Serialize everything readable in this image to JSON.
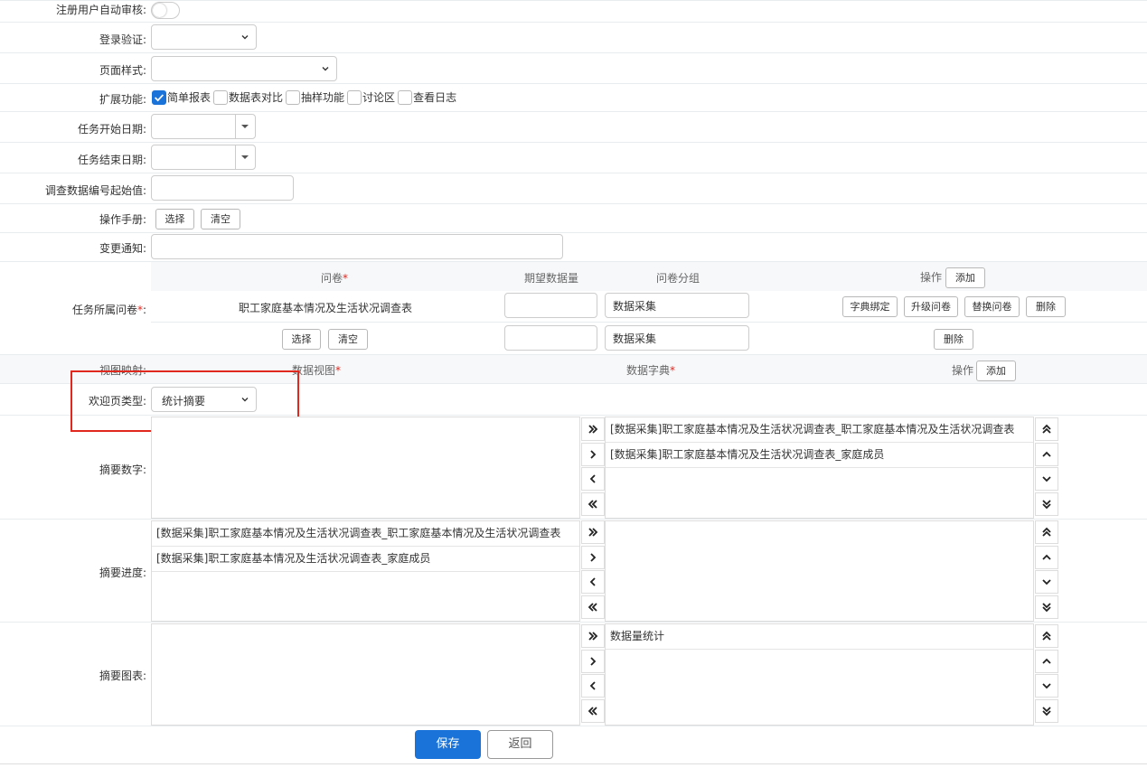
{
  "form": {
    "auto_review_label": "注册用户自动审核:",
    "login_verify_label": "登录验证:",
    "page_style_label": "页面样式:",
    "extensions_label": "扩展功能:",
    "extensions": [
      {
        "label": "简单报表",
        "checked": true
      },
      {
        "label": "数据表对比",
        "checked": false
      },
      {
        "label": "抽样功能",
        "checked": false
      },
      {
        "label": "讨论区",
        "checked": false
      },
      {
        "label": "查看日志",
        "checked": false
      }
    ],
    "task_start_label": "任务开始日期:",
    "task_end_label": "任务结束日期:",
    "survey_start_label": "调查数据编号起始值:",
    "manual_label": "操作手册:",
    "manual_select": "选择",
    "manual_clear": "清空",
    "change_notice_label": "变更通知:",
    "questionnaire_label": "任务所属问卷",
    "required_mark": "*",
    "colon": ":",
    "welcome_label": "欢迎页类型:",
    "welcome_value": "统计摘要",
    "view_map_label": "视图映射:",
    "summary_number_label": "摘要数字:",
    "summary_progress_label": "摘要进度:",
    "summary_chart_label": "摘要图表:"
  },
  "questionnaire_table": {
    "col_questionnaire": "问卷",
    "col_expected": "期望数据量",
    "col_group": "问卷分组",
    "col_action": "操作",
    "add_label": "添加",
    "rows": [
      {
        "name": "职工家庭基本情况及生活状况调查表",
        "expected": "",
        "group": "数据采集",
        "actions": [
          "字典绑定",
          "升级问卷",
          "替换问卷",
          "删除"
        ]
      },
      {
        "select_label": "选择",
        "clear_label": "清空",
        "expected": "",
        "group": "数据采集",
        "actions": [
          "删除"
        ]
      }
    ]
  },
  "view_map_table": {
    "col_view": "数据视图",
    "col_dict": "数据字典",
    "col_action": "操作",
    "add_label": "添加"
  },
  "summary_number": {
    "left_items": [],
    "right_items": [
      "[数据采集]职工家庭基本情况及生活状况调查表_职工家庭基本情况及生活状况调查表",
      "[数据采集]职工家庭基本情况及生活状况调查表_家庭成员"
    ]
  },
  "summary_progress": {
    "left_items": [
      "[数据采集]职工家庭基本情况及生活状况调查表_职工家庭基本情况及生活状况调查表",
      "[数据采集]职工家庭基本情况及生活状况调查表_家庭成员"
    ],
    "right_items": []
  },
  "summary_chart": {
    "left_items": [],
    "right_items": [
      "数据量统计"
    ]
  },
  "footer": {
    "save_label": "保存",
    "back_label": "返回"
  },
  "colors": {
    "primary": "#1a73d9",
    "highlight_box": "#e0281f",
    "required": "#e0281f"
  },
  "icons": {
    "move_all_right": "double-chevron-right-icon",
    "move_right": "chevron-right-icon",
    "move_left": "chevron-left-icon",
    "move_all_left": "double-chevron-left-icon",
    "move_top": "double-chevron-up-icon",
    "move_up": "chevron-up-icon",
    "move_down": "chevron-down-icon",
    "move_bottom": "double-chevron-down-icon"
  }
}
